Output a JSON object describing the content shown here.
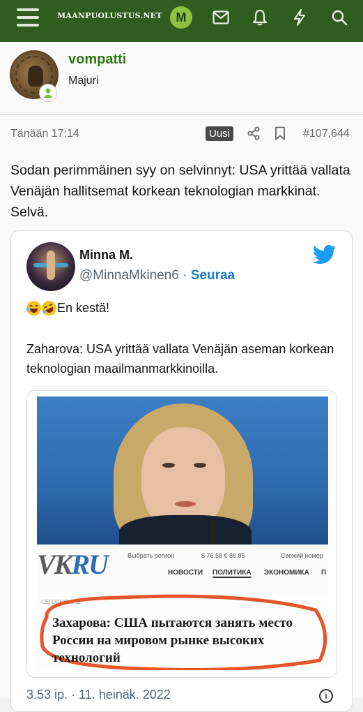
{
  "topbar": {
    "site_title": "MAANPUOLUSTUS.NET",
    "user_initial": "M",
    "icons": [
      "menu-icon",
      "mail-icon",
      "bell-icon",
      "lightning-icon",
      "search-icon"
    ]
  },
  "post": {
    "author": "vompatti",
    "rank": "Majuri",
    "time": "Tänään 17:14",
    "badge": "Uusi",
    "number": "#107,644",
    "text": "Sodan perimmäinen syy on selvinnyt: USA yrittää vallata Venäjän hallitsemat korkean teknologian markkinat. Selvä."
  },
  "tweet": {
    "name": "Minna M.",
    "handle": "@MinnaMkinen6",
    "separator": "·",
    "follow": "Seuraa",
    "line1": "En kestä!",
    "line2": "Zaharova: USA yrittää vallata Venäjän aseman korkean teknologian maailmanmarkkinoilla.",
    "date": "3.53 ip. · 11. heinäk. 2022",
    "image": {
      "logo_vk": "VK",
      "logo_ru": "RU",
      "region": "Выбрать регион",
      "rates": "$ 76.58  € 86.85",
      "top_right": "Свежий номер",
      "menu": [
        "НОВОСТИ",
        "ПОЛИТИКА",
        "ЭКОНОМИКА",
        "П"
      ],
      "date_small": "СЕГОДНЯ, 8:11",
      "headline": "Захарова: США пытаются занять место России на мировом рынке высоких технологий"
    }
  },
  "colors": {
    "topbar": "#2e5d1f",
    "username": "#2f7a12",
    "follow": "#1d7bc8",
    "twitter_blue": "#1d9bf0",
    "red_circle": "#e4562a"
  }
}
